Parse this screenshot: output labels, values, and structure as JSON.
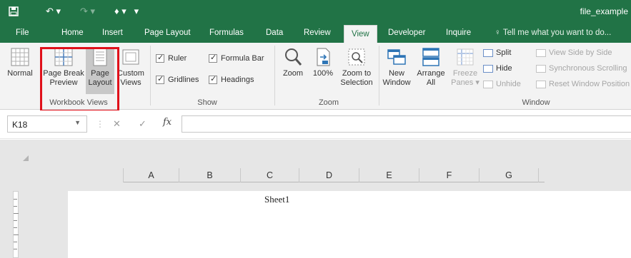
{
  "window": {
    "filename": "file_example"
  },
  "tabs": [
    {
      "label": "File"
    },
    {
      "label": "Home"
    },
    {
      "label": "Insert"
    },
    {
      "label": "Page Layout"
    },
    {
      "label": "Formulas"
    },
    {
      "label": "Data"
    },
    {
      "label": "Review"
    },
    {
      "label": "View",
      "active": true
    },
    {
      "label": "Developer"
    },
    {
      "label": "Inquire"
    }
  ],
  "tell_me": "Tell me what you want to do...",
  "ribbon": {
    "workbook_views": {
      "label": "Workbook Views",
      "normal": "Normal",
      "page_break_1": "Page Break",
      "page_break_2": "Preview",
      "page_layout_1": "Page",
      "page_layout_2": "Layout",
      "custom_1": "Custom",
      "custom_2": "Views"
    },
    "show": {
      "label": "Show",
      "ruler": "Ruler",
      "formula_bar": "Formula Bar",
      "gridlines": "Gridlines",
      "headings": "Headings"
    },
    "zoom": {
      "label": "Zoom",
      "zoom": "Zoom",
      "pct": "100%",
      "to_sel_1": "Zoom to",
      "to_sel_2": "Selection"
    },
    "window": {
      "label": "Window",
      "new_1": "New",
      "new_2": "Window",
      "arrange_1": "Arrange",
      "arrange_2": "All",
      "freeze_1": "Freeze",
      "freeze_2": "Panes",
      "split": "Split",
      "hide": "Hide",
      "unhide": "Unhide",
      "side_by_side": "View Side by Side",
      "sync_scroll": "Synchronous Scrolling",
      "reset_pos": "Reset Window Position"
    }
  },
  "formula_bar": {
    "name_box": "K18",
    "fx": "fx",
    "cancel_glyph": "✕",
    "enter_glyph": "✓",
    "value": ""
  },
  "sheet": {
    "columns": [
      "A",
      "B",
      "C",
      "D",
      "E",
      "F",
      "G"
    ],
    "header_text": "Sheet1"
  },
  "colors": {
    "accent": "#217346",
    "highlight_box": "#e0101a"
  }
}
